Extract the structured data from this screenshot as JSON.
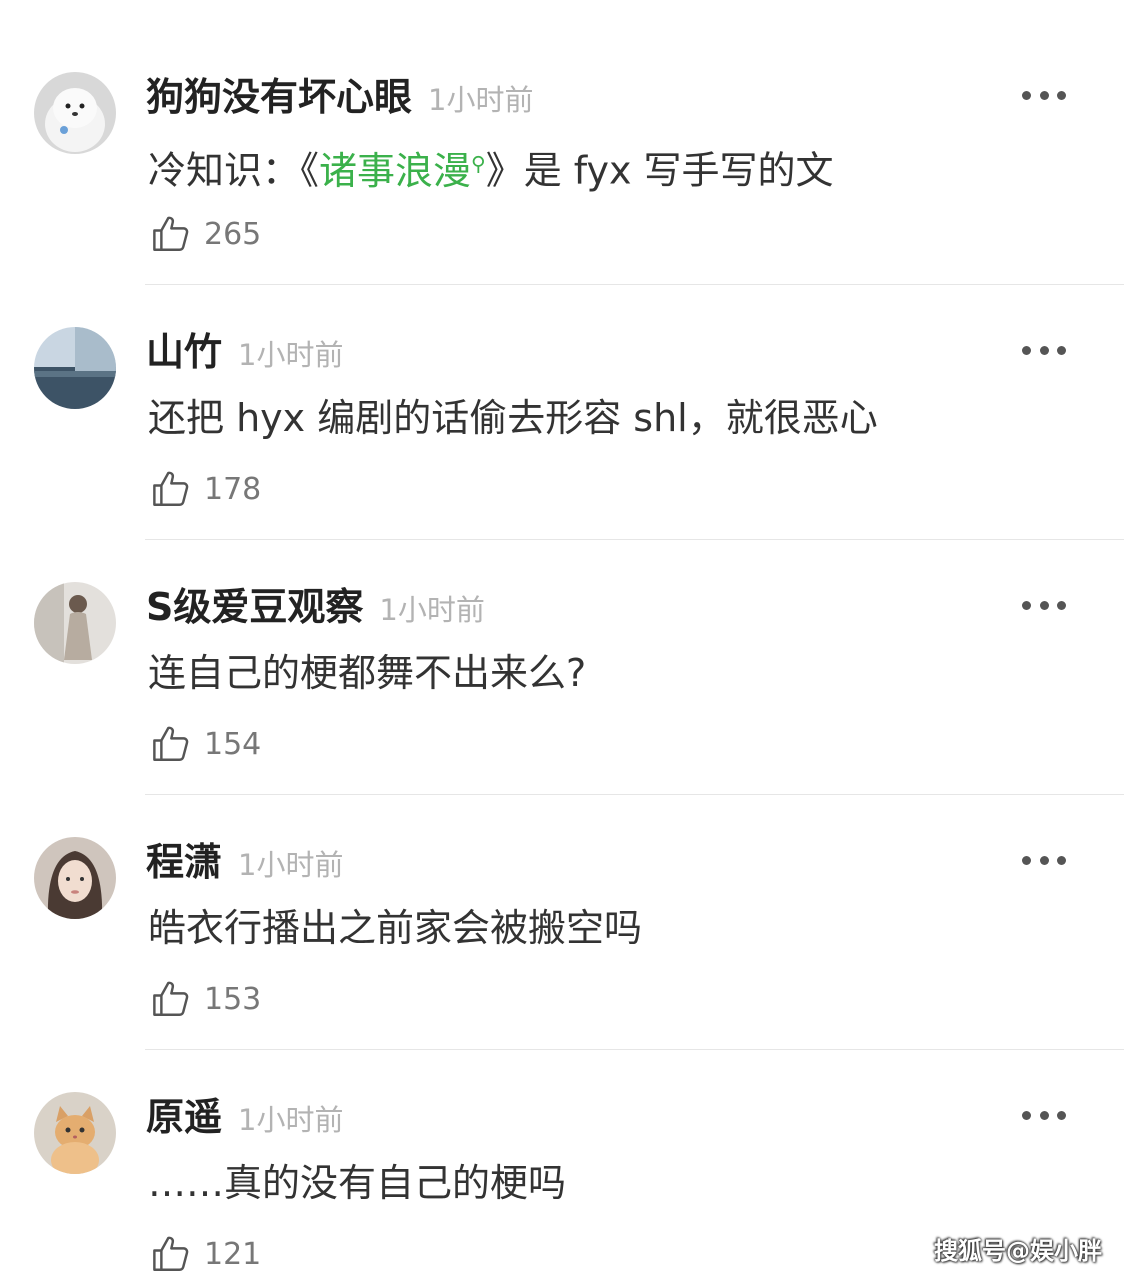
{
  "comments": [
    {
      "username": "狗狗没有坏心眼",
      "time": "1小时前",
      "text_before": "冷知识：《",
      "topic": "诸事浪漫",
      "text_after": "》是 fyx 写手写的文",
      "likes": "265",
      "avatar_icon": "samoyed-dog-avatar"
    },
    {
      "username": "山竹",
      "time": "1小时前",
      "text": "还把 hyx 编剧的话偷去形容 shl，就很恶心",
      "likes": "178",
      "avatar_icon": "seascape-avatar"
    },
    {
      "username": "S级爱豆观察",
      "time": "1小时前",
      "text": "连自己的梗都舞不出来么?",
      "likes": "154",
      "avatar_icon": "dancer-avatar"
    },
    {
      "username": "程潇",
      "time": "1小时前",
      "text": "皓衣行播出之前家会被搬空吗",
      "likes": "153",
      "avatar_icon": "girl-portrait-avatar"
    },
    {
      "username": "原遥",
      "time": "1小时前",
      "text": "……真的没有自己的梗吗",
      "likes": "121",
      "avatar_icon": "cat-avatar"
    }
  ],
  "watermark": "搜狐号@娱小胖",
  "colors": {
    "topic_link": "#3bb14b",
    "time_gray": "#b3b3b3",
    "name_black": "#222222"
  }
}
